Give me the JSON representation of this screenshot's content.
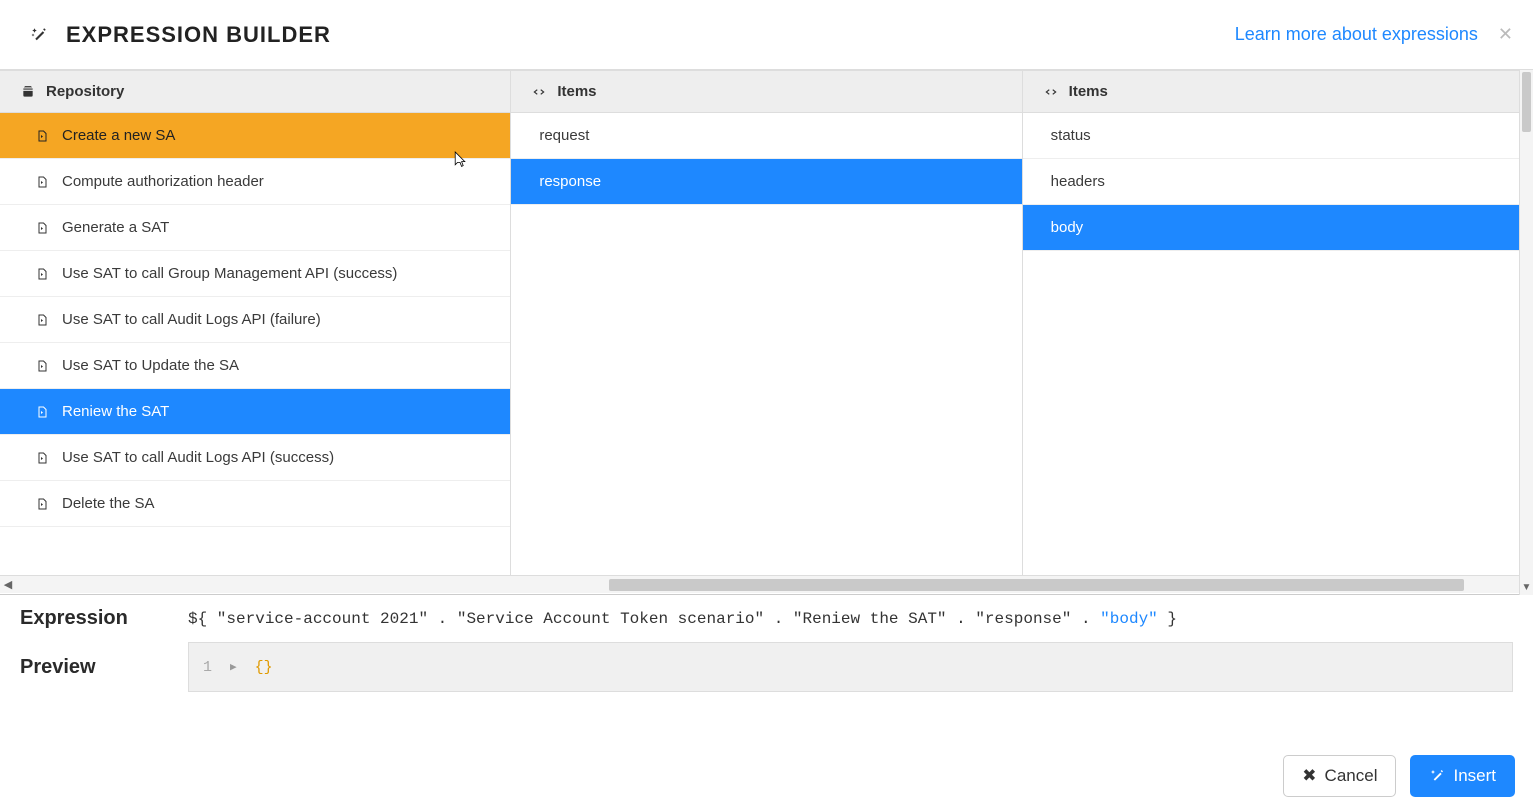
{
  "header": {
    "title": "EXPRESSION BUILDER",
    "learn_link": "Learn more about expressions"
  },
  "columns": {
    "col1": {
      "header": "Repository",
      "items": [
        {
          "label": "Create a new SA",
          "state": "orange"
        },
        {
          "label": "Compute authorization header",
          "state": ""
        },
        {
          "label": "Generate a SAT",
          "state": ""
        },
        {
          "label": "Use SAT to call Group Management API (success)",
          "state": ""
        },
        {
          "label": "Use SAT to call Audit Logs API (failure)",
          "state": ""
        },
        {
          "label": "Use SAT to Update the SA",
          "state": ""
        },
        {
          "label": "Reniew the SAT",
          "state": "selected"
        },
        {
          "label": "Use SAT to call Audit Logs API (success)",
          "state": ""
        },
        {
          "label": "Delete the SA",
          "state": ""
        }
      ]
    },
    "col2": {
      "header": "Items",
      "items": [
        {
          "label": "request",
          "state": ""
        },
        {
          "label": "response",
          "state": "selected"
        }
      ]
    },
    "col3": {
      "header": "Items",
      "items": [
        {
          "label": "status",
          "state": ""
        },
        {
          "label": "headers",
          "state": ""
        },
        {
          "label": "body",
          "state": "selected"
        }
      ]
    }
  },
  "expression": {
    "label": "Expression",
    "prefix": "${ \"service-account 2021\" . \"Service Account Token scenario\" . \"Reniew the SAT\" . \"response\" . ",
    "last": "\"body\"",
    "suffix": " }"
  },
  "preview": {
    "label": "Preview",
    "lineno": "1",
    "content": "{}"
  },
  "buttons": {
    "cancel": "Cancel",
    "insert": "Insert"
  }
}
